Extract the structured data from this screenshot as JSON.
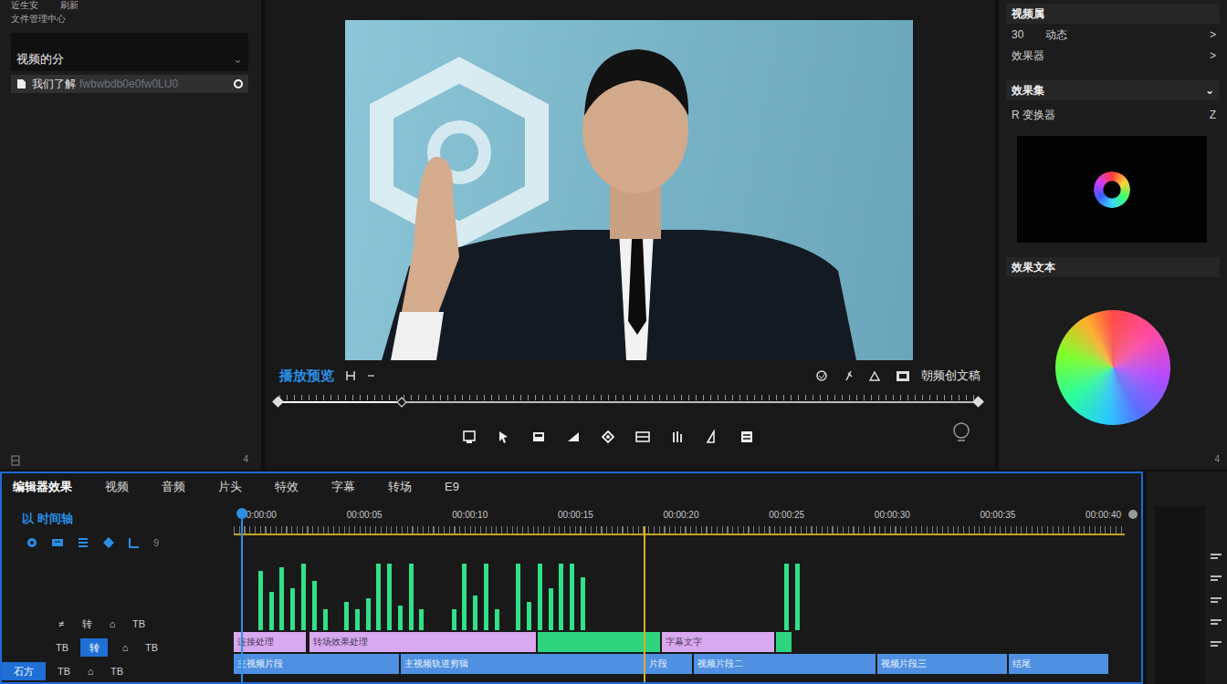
{
  "media_browser": {
    "top_labels": [
      "近生安",
      "刷新"
    ],
    "subtitle": "文件管理中心",
    "folder": "视频的分",
    "folder_toggle": "⌄",
    "files": [
      {
        "name": "我们了解",
        "path": "fwbwbdb0e0fw0LU0",
        "selected": true
      }
    ],
    "corner": "4"
  },
  "monitor": {
    "title": "播放预览",
    "export_label": "朝频创文稿",
    "scrub_level": 0.18
  },
  "inspector": {
    "title": "视频属",
    "rows": [
      {
        "label": "30",
        "value": "动态",
        "arrow": ">"
      },
      {
        "label": "效果器",
        "value": "",
        "arrow": ">"
      }
    ],
    "effects_header": "效果集",
    "effects_toggle": "⌄",
    "effect_item": "R 变换器",
    "effect_key": "Z",
    "text_header": "效果文本",
    "corner": "4"
  },
  "timeline": {
    "tabs": [
      {
        "label": "编辑器效果",
        "selected": true
      },
      {
        "label": "视频",
        "selected": false
      },
      {
        "label": "音频",
        "selected": false
      },
      {
        "label": "片头",
        "selected": false
      },
      {
        "label": "特效",
        "selected": false
      },
      {
        "label": "字幕",
        "selected": false
      },
      {
        "label": "转场",
        "selected": false
      },
      {
        "label": "E9",
        "selected": false
      }
    ],
    "title": "以 时间轴",
    "tool_count": "9",
    "timecodes": [
      "00:00:00",
      "00:00:05",
      "00:00:10",
      "00:00:15",
      "00:00:20",
      "00:00:25",
      "00:00:30",
      "00:00:35",
      "00:00:40"
    ],
    "playhead": 0.4,
    "marker": 19.4,
    "waveform": [
      0,
      0,
      0.85,
      0.55,
      0.9,
      0.6,
      0.95,
      0.7,
      0.3,
      0,
      0.4,
      0.3,
      0.45,
      0.95,
      0.95,
      0.35,
      0.95,
      0.3,
      0,
      0,
      0.3,
      0.95,
      0.5,
      0.95,
      0.3,
      0,
      0.95,
      0.4,
      0.95,
      0.6,
      0.95,
      0.95,
      0.75,
      0,
      0,
      0,
      0,
      0,
      0,
      0,
      0,
      0,
      0,
      0,
      0,
      0,
      0,
      0,
      0,
      0,
      0,
      0.95,
      0.95,
      0,
      0,
      0,
      0,
      0,
      0,
      0,
      0,
      0,
      0,
      0,
      0,
      0,
      0,
      0,
      0,
      0,
      0,
      0,
      0,
      0,
      0,
      0,
      0,
      0,
      0,
      0,
      0,
      0,
      0
    ],
    "track_headers": [
      {
        "cells": [
          {
            "text": "≠",
            "selected": false
          },
          {
            "text": "转",
            "selected": false
          },
          {
            "text": "⌂",
            "selected": false
          },
          {
            "text": "TB",
            "selected": false
          }
        ]
      },
      {
        "cells": [
          {
            "text": "TB",
            "selected": false
          },
          {
            "text": "转",
            "selected": true
          },
          {
            "text": "⌂",
            "selected": false
          },
          {
            "text": "TB",
            "selected": false
          }
        ]
      },
      {
        "cells": [
          {
            "text": "石方",
            "selected": true
          },
          {
            "text": "TB",
            "selected": false
          },
          {
            "text": "⌂",
            "selected": false
          },
          {
            "text": "TB",
            "selected": false
          }
        ]
      }
    ],
    "clip_rows": [
      [
        {
          "label": "连接处理",
          "start": 0,
          "end": 3.5,
          "color": "#d8a8f0"
        },
        {
          "label": "转场效果处理",
          "start": 3.6,
          "end": 14.4,
          "color": "#d8a8f0"
        },
        {
          "start": 14.4,
          "end": 20.3,
          "color": "#2fd47f"
        },
        {
          "label": "字幕文字",
          "start": 20.3,
          "end": 25.7,
          "color": "#d8a8f0"
        },
        {
          "start": 25.7,
          "end": 26.5,
          "color": "#2fd47f"
        }
      ],
      [
        {
          "label": "主视频片段",
          "start": 0,
          "end": 7.9,
          "color": "#4f90e2"
        },
        {
          "label": "主视频轨道剪辑",
          "start": 7.9,
          "end": 19.5,
          "color": "#4f90e2"
        },
        {
          "label": "片段",
          "start": 19.5,
          "end": 21.8,
          "color": "#4f90e2"
        },
        {
          "label": "视频片段二",
          "start": 21.8,
          "end": 30.5,
          "color": "#4f90e2"
        },
        {
          "label": "视频片段三",
          "start": 30.5,
          "end": 36.7,
          "color": "#4f90e2"
        },
        {
          "label": "结尾",
          "start": 36.7,
          "end": 41.5,
          "color": "#4f90e2"
        }
      ]
    ]
  }
}
